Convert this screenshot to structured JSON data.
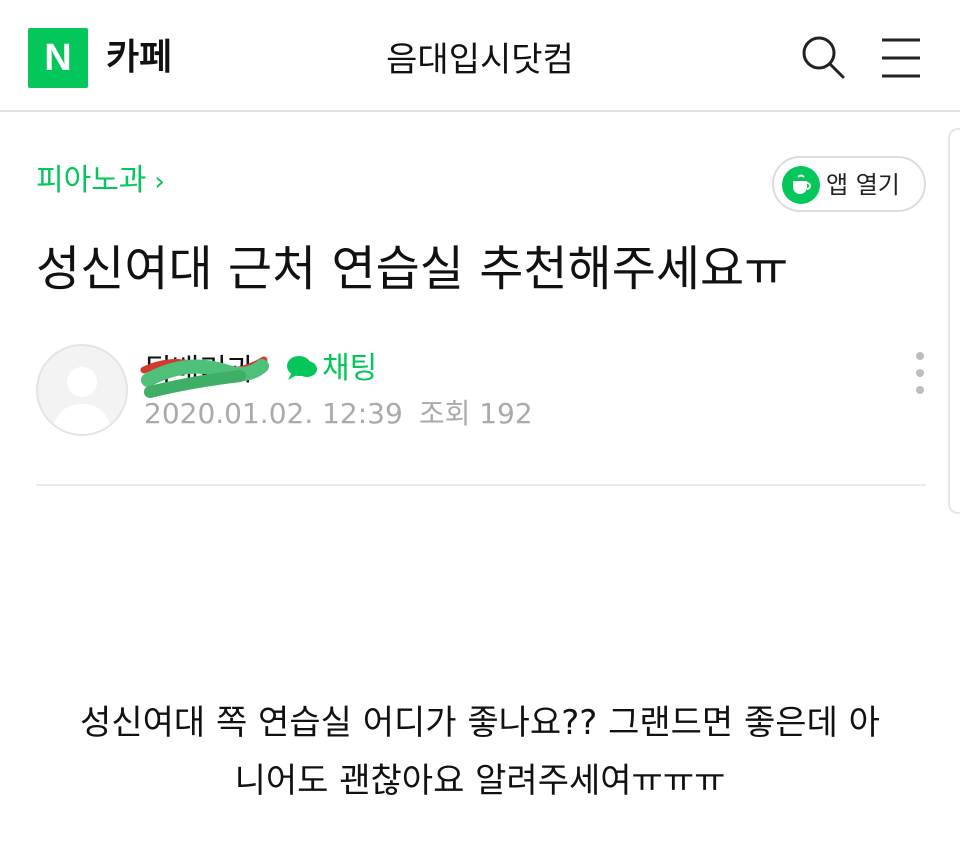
{
  "header": {
    "logo_letter": "N",
    "service_name": "카페",
    "cafe_name": "음대입시닷컴",
    "brand_color": "#03c75a",
    "icons": [
      "search-icon",
      "menu-icon"
    ]
  },
  "board": {
    "name": "피아노과",
    "chevron": "›"
  },
  "app_button": {
    "label": "앱 열기",
    "icon": "cafe-app-icon"
  },
  "post": {
    "title": "성신여대 근처 연습실 추천해주세요ㅠ",
    "author": "뒤배리과",
    "chat_label": "채팅",
    "date": "2020.01.02. 12:39",
    "views_label": "조회 192",
    "body_line1": "성신여대 쪽 연습실 어디가 좋나요?? 그랜드면 좋은데 아",
    "body_line2": "니어도 괜찮아요 알려주세여ㅠㅠㅠ"
  }
}
